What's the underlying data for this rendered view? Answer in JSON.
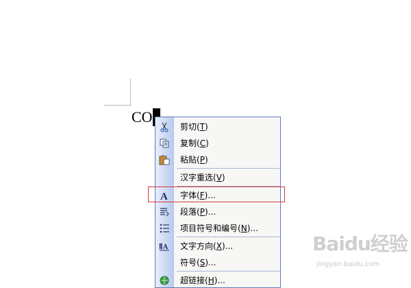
{
  "document": {
    "text_before": "CO",
    "selected_text": "\u0000"
  },
  "context_menu": {
    "items": [
      {
        "label": "剪切",
        "key": "T"
      },
      {
        "label": "复制",
        "key": "C"
      },
      {
        "label": "粘贴",
        "key": "P"
      },
      {
        "label": "汉字重选",
        "key": "V"
      },
      {
        "label": "字体",
        "key": "F",
        "suffix": "..."
      },
      {
        "label": "段落",
        "key": "P",
        "suffix": "..."
      },
      {
        "label": "项目符号和编号",
        "key": "N",
        "suffix": "..."
      },
      {
        "label": "文字方向",
        "key": "X",
        "suffix": "..."
      },
      {
        "label": "符号",
        "key": "S",
        "suffix": "..."
      },
      {
        "label": "超链接",
        "key": "H",
        "suffix": "..."
      }
    ],
    "icons": [
      "scissors-icon",
      "copy-icon",
      "paste-icon",
      "",
      "font-icon",
      "paragraph-icon",
      "bullets-icon",
      "text-direction-icon",
      "",
      "hyperlink-icon"
    ]
  },
  "colors": {
    "menu_border": "#5a7ab8",
    "highlight": "#d43a3a"
  },
  "watermark": {
    "brand": "Baidu经验",
    "url": "jingyan.baidu.com"
  }
}
